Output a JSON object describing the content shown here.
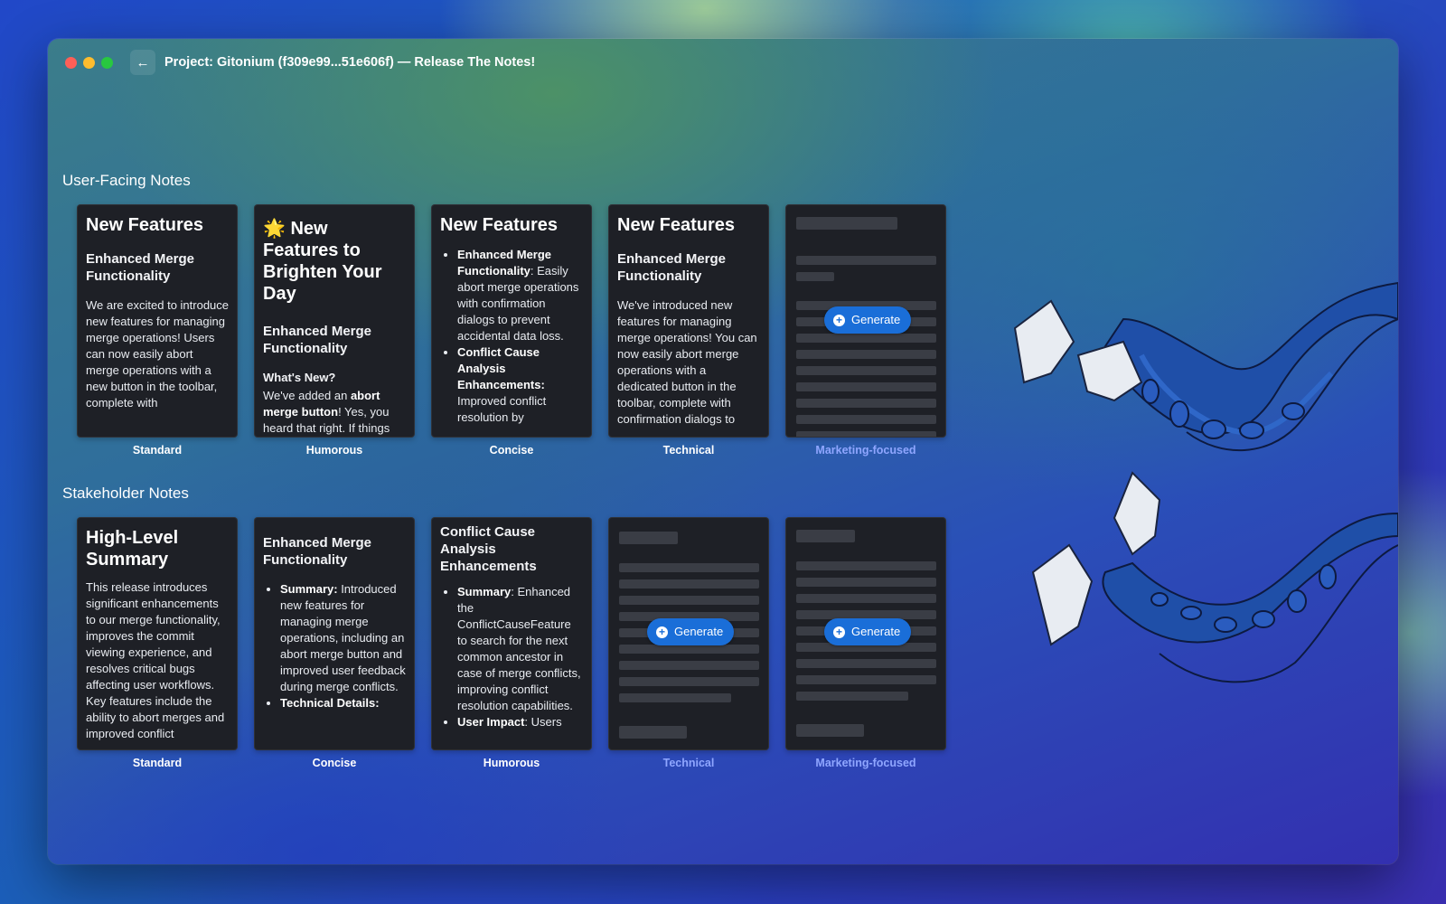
{
  "window": {
    "title": "Project: Gitonium (f309e99...51e606f) — Release The Notes!",
    "back_icon": "arrow-left-icon"
  },
  "user_notes": {
    "heading": "User-Facing Notes",
    "cards": [
      {
        "caption": "Standard",
        "title": "New Features",
        "subtitle": "Enhanced Merge Functionality",
        "body": "We are excited to introduce new features for managing merge operations! Users can now easily abort merge operations with a new button in the toolbar, complete with"
      },
      {
        "caption": "Humorous",
        "emoji": "🌟",
        "title": "New Features to Brighten Your Day",
        "subtitle": "Enhanced Merge Functionality",
        "label": "What's New?",
        "body_pre": "We've added an ",
        "body_bold": "abort merge button",
        "body_post": "! Yes, you heard that right. If things get messy during a"
      },
      {
        "caption": "Concise",
        "title": "New Features",
        "items": [
          {
            "bold": "Enhanced Merge Functionality",
            "text": ": Easily abort merge operations with confirmation dialogs to prevent accidental data loss."
          },
          {
            "bold": "Conflict Cause Analysis Enhancements:",
            "text": " Improved conflict resolution by"
          }
        ]
      },
      {
        "caption": "Technical",
        "title": "New Features",
        "subtitle": "Enhanced Merge Functionality",
        "body": "We've introduced new features for managing merge operations! You can now easily abort merge operations with a dedicated button in the toolbar, complete with confirmation dialogs to"
      },
      {
        "caption": "Marketing-focused",
        "button": "Generate"
      }
    ]
  },
  "stakeholder_notes": {
    "heading": "Stakeholder Notes",
    "cards": [
      {
        "caption": "Standard",
        "title": "High-Level Summary",
        "body": "This release introduces significant enhancements to our merge functionality, improves the commit viewing experience, and resolves critical bugs affecting user workflows. Key features include the ability to abort merges and improved conflict"
      },
      {
        "caption": "Concise",
        "subtitle": "Enhanced Merge Functionality",
        "items": [
          {
            "bold": "Summary:",
            "text": " Introduced new features for managing merge operations, including an abort merge button and improved user feedback during merge conflicts."
          },
          {
            "bold": "Technical Details:",
            "text": ""
          }
        ]
      },
      {
        "caption": "Humorous",
        "subtitle": "Conflict Cause Analysis Enhancements",
        "items": [
          {
            "bold": "Summary",
            "text": ": Enhanced the ConflictCauseFeature to search for the next common ancestor in case of merge conflicts, improving conflict resolution capabilities."
          },
          {
            "bold": "User Impact",
            "text": ": Users"
          }
        ]
      },
      {
        "caption": "Technical",
        "button": "Generate"
      },
      {
        "caption": "Marketing-focused",
        "button": "Generate"
      }
    ]
  },
  "colors": {
    "card_bg": "#1e2026",
    "accent_button": "#1a6ed8",
    "disabled_caption": "#8fa6ff"
  }
}
